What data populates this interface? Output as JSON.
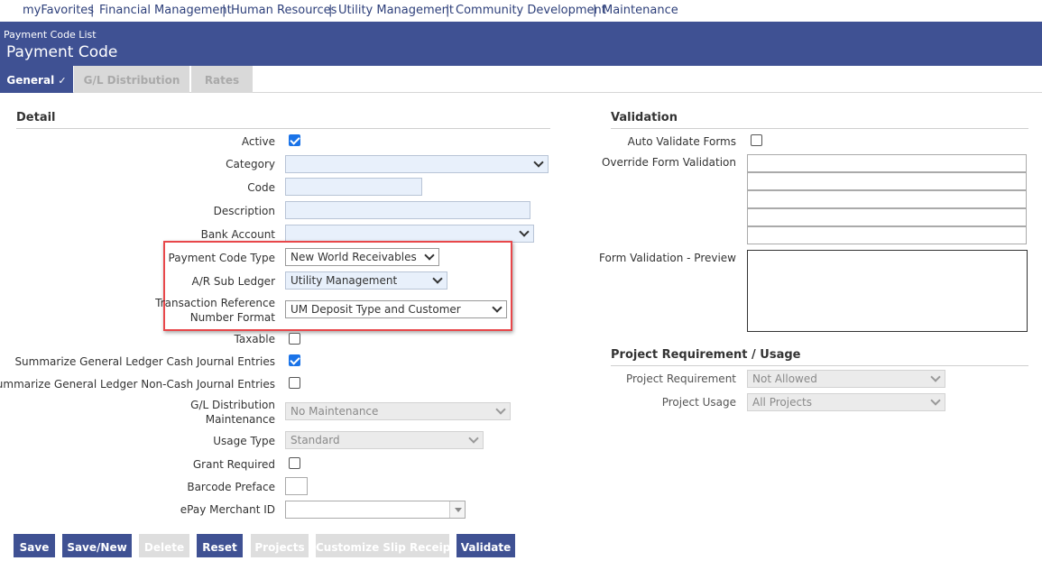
{
  "nav": {
    "items": [
      "myFavorites",
      "Financial Management",
      "Human Resources",
      "Utility Management",
      "Community Development",
      "Maintenance"
    ],
    "separator": "|"
  },
  "header": {
    "breadcrumb": "Payment Code List",
    "title": "Payment Code"
  },
  "tabs": {
    "general": "General",
    "general_check": "✓",
    "gl_distribution": "G/L Distribution",
    "rates": "Rates"
  },
  "detail": {
    "title": "Detail",
    "active_label": "Active",
    "active_checked": true,
    "category_label": "Category",
    "category_value": "",
    "code_label": "Code",
    "code_value": "",
    "description_label": "Description",
    "description_value": "",
    "bank_account_label": "Bank Account",
    "bank_account_value": "",
    "payment_code_type_label": "Payment Code Type",
    "payment_code_type_value": "New World Receivables",
    "ar_sub_ledger_label": "A/R Sub Ledger",
    "ar_sub_ledger_value": "Utility Management",
    "trn_format_label_1": "Transaction Reference",
    "trn_format_label_2": "Number Format",
    "trn_format_value": "UM Deposit Type and Customer",
    "taxable_label": "Taxable",
    "taxable_checked": false,
    "summ_cash_label": "Summarize General Ledger Cash Journal Entries",
    "summ_cash_checked": true,
    "summ_noncash_label": "Summarize General Ledger Non-Cash Journal Entries",
    "summ_noncash_checked": false,
    "gl_dist_label_1": "G/L Distribution",
    "gl_dist_label_2": "Maintenance",
    "gl_dist_value": "No Maintenance",
    "usage_type_label": "Usage Type",
    "usage_type_value": "Standard",
    "grant_required_label": "Grant Required",
    "grant_required_checked": false,
    "barcode_preface_label": "Barcode Preface",
    "barcode_preface_value": "",
    "epay_merchant_label": "ePay Merchant ID",
    "epay_merchant_value": ""
  },
  "validation": {
    "title": "Validation",
    "auto_validate_label": "Auto Validate Forms",
    "auto_validate_checked": false,
    "override_label": "Override Form Validation",
    "preview_label": "Form Validation - Preview"
  },
  "project": {
    "title": "Project Requirement / Usage",
    "requirement_label": "Project Requirement",
    "requirement_value": "Not Allowed",
    "usage_label": "Project Usage",
    "usage_value": "All Projects"
  },
  "buttons": {
    "save": "Save",
    "save_new": "Save/New",
    "delete": "Delete",
    "reset": "Reset",
    "projects": "Projects",
    "customize_slip": "Customize Slip Receipt",
    "validate": "Validate"
  },
  "colors": {
    "brand": "#3f5193",
    "nav_text": "#2d3f7a",
    "highlight": "#e8474a",
    "checkbox": "#1a73e8"
  }
}
